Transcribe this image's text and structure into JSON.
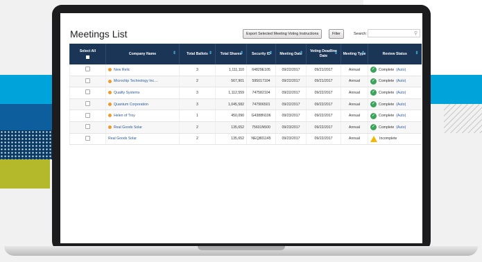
{
  "page": {
    "title": "Meetings List",
    "export_label": "Export Selected Meeting Voting Instructions",
    "filter_label": "Filter",
    "search_label": "Search:",
    "search_value": ""
  },
  "table": {
    "headers": {
      "select_all": "Select All",
      "company": "Company Name",
      "ballots": "Total Ballots",
      "shares": "Total Shares",
      "security": "Security ID",
      "meeting_date": "Meeting Date",
      "deadline": "Voting Deadline Date",
      "type": "Meeting Type",
      "review": "Review Status"
    },
    "rows": [
      {
        "company": "New Relic",
        "ballots": "3",
        "shares": "1,111,110",
        "security": "64829E105",
        "meeting_date": "09/22/2017",
        "deadline": "09/21/2017",
        "type": "Annual",
        "status": "Complete",
        "auto": "(Auto)",
        "status_kind": "complete",
        "flag": true
      },
      {
        "company": "Microchip Technology Inc....",
        "ballots": "2",
        "shares": "567,901",
        "security": "595017104",
        "meeting_date": "09/22/2017",
        "deadline": "09/21/2017",
        "type": "Annual",
        "status": "Complete",
        "auto": "(Auto)",
        "status_kind": "complete",
        "flag": true
      },
      {
        "company": "Quality Systems",
        "ballots": "3",
        "shares": "1,112,559",
        "security": "747582104",
        "meeting_date": "09/22/2017",
        "deadline": "09/22/2017",
        "type": "Annual",
        "status": "Complete",
        "auto": "(Auto)",
        "status_kind": "complete",
        "flag": true
      },
      {
        "company": "Quantum Corporation",
        "ballots": "3",
        "shares": "1,045,582",
        "security": "747906501",
        "meeting_date": "09/22/2017",
        "deadline": "09/22/2017",
        "type": "Annual",
        "status": "Complete",
        "auto": "(Auto)",
        "status_kind": "complete",
        "flag": true
      },
      {
        "company": "Helen of Troy",
        "ballots": "1",
        "shares": "450,090",
        "security": "G4388N106",
        "meeting_date": "09/23/2017",
        "deadline": "09/22/2017",
        "type": "Annual",
        "status": "Complete",
        "auto": "(Auto)",
        "status_kind": "complete",
        "flag": true
      },
      {
        "company": "Real Goods Solar",
        "ballots": "2",
        "shares": "135,652",
        "security": "75601N500",
        "meeting_date": "09/23/2017",
        "deadline": "09/22/2017",
        "type": "Annual",
        "status": "Complete",
        "auto": "(Auto)",
        "status_kind": "complete",
        "flag": true
      },
      {
        "company": "Real Goods Solar",
        "ballots": "2",
        "shares": "135,652",
        "security": "NEQ801145",
        "meeting_date": "09/23/2017",
        "deadline": "09/22/2017",
        "type": "Annual",
        "status": "Incomplete",
        "auto": "",
        "status_kind": "incomplete",
        "flag": false
      }
    ]
  },
  "colors": {
    "header_bg": "#1b3557",
    "accent": "#00a3da",
    "flag": "#f09a2a",
    "complete": "#3aa55a",
    "warning": "#f2b705"
  },
  "icons": {
    "sort": "sort-arrows-icon",
    "search": "search-icon",
    "complete": "check-circle-icon",
    "incomplete": "warning-triangle-icon",
    "flag": "orange-dot-icon"
  }
}
